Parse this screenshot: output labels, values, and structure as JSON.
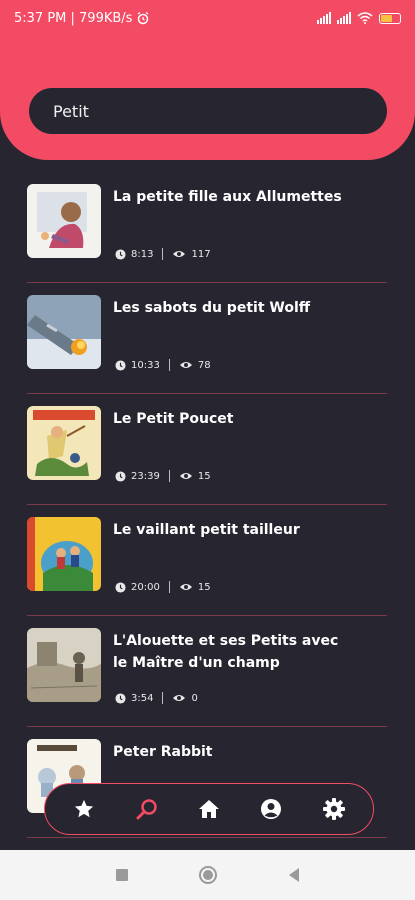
{
  "status": {
    "time_speed": "5:37 PM | 799KB/s",
    "battery": "58"
  },
  "search": {
    "value": "Petit"
  },
  "items": [
    {
      "title": "La petite fille aux Allumettes",
      "duration": "8:13",
      "views": "117"
    },
    {
      "title": "Les sabots du petit Wolff",
      "duration": "10:33",
      "views": "78"
    },
    {
      "title": "Le Petit Poucet",
      "duration": "23:39",
      "views": "15"
    },
    {
      "title": "Le vaillant petit tailleur",
      "duration": "20:00",
      "views": "15"
    },
    {
      "title": "L'Alouette et ses Petits avec le Maître d'un champ",
      "duration": "3:54",
      "views": "0"
    },
    {
      "title": "Peter Rabbit",
      "duration": "",
      "views": ""
    }
  ],
  "nav": {
    "items": [
      "star-icon",
      "search-icon",
      "home-icon",
      "account-icon",
      "settings-icon"
    ],
    "active": "search-icon"
  },
  "colors": {
    "accent": "#f24b63",
    "background": "#262530",
    "divider": "#7c3a4a"
  }
}
